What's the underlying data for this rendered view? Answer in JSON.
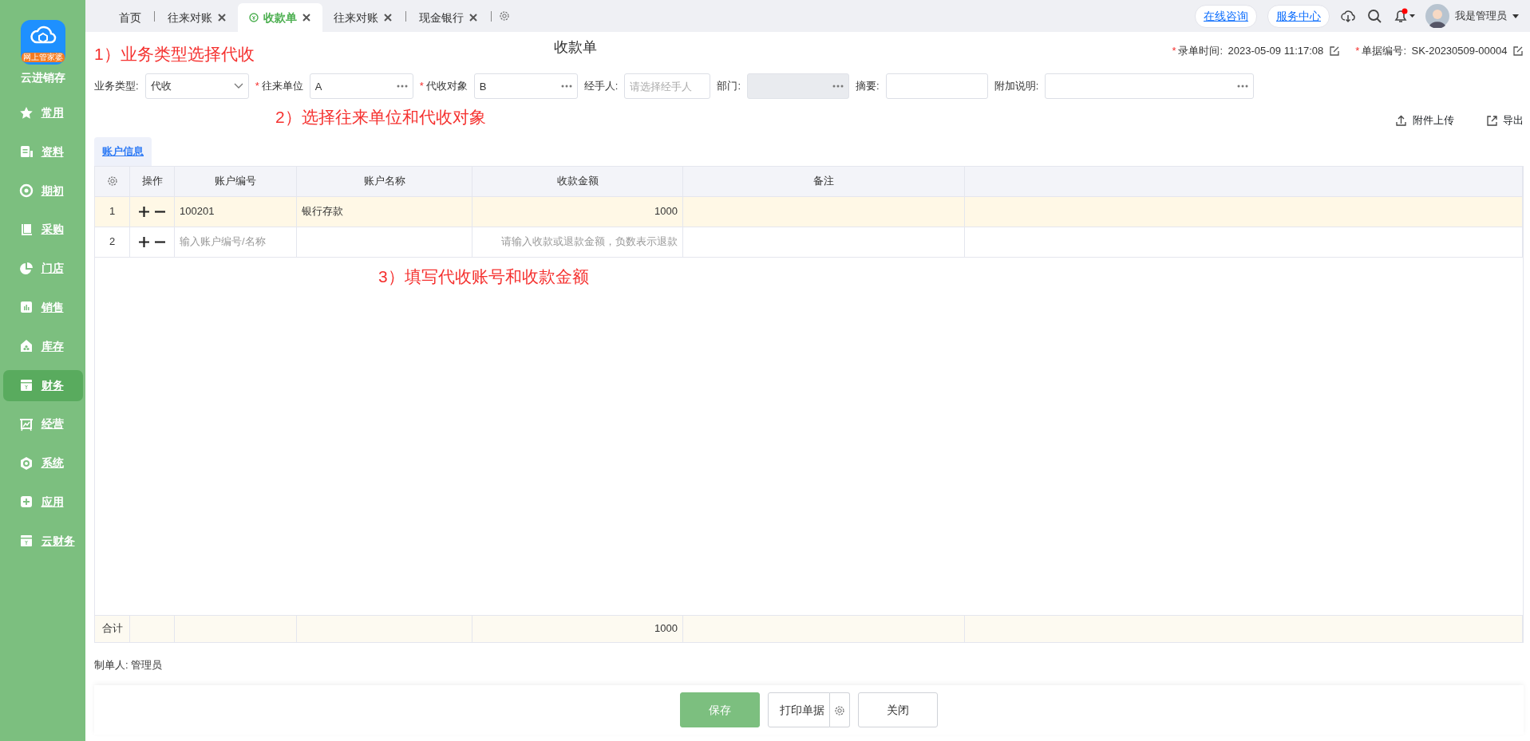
{
  "sidebar": {
    "logo_badge": "网上管家婆",
    "app_name": "云进销存",
    "items": [
      {
        "label": "常用",
        "selected": false
      },
      {
        "label": "资料",
        "selected": false
      },
      {
        "label": "期初",
        "selected": false
      },
      {
        "label": "采购",
        "selected": false
      },
      {
        "label": "门店",
        "selected": false
      },
      {
        "label": "销售",
        "selected": false
      },
      {
        "label": "库存",
        "selected": false
      },
      {
        "label": "财务",
        "selected": true
      },
      {
        "label": "经营",
        "selected": false
      },
      {
        "label": "系统",
        "selected": false
      },
      {
        "label": "应用",
        "selected": false
      },
      {
        "label": "云财务",
        "selected": false
      }
    ]
  },
  "tabs": [
    {
      "label": "首页",
      "selected": false,
      "closable": false
    },
    {
      "label": "往来对账",
      "selected": false,
      "closable": true
    },
    {
      "label": "收款单",
      "selected": true,
      "closable": true
    },
    {
      "label": "往来对账",
      "selected": false,
      "closable": true
    },
    {
      "label": "现金银行",
      "selected": false,
      "closable": true
    }
  ],
  "top_links": [
    "在线咨询",
    "服务中心"
  ],
  "notification_dot": true,
  "required_mark": "*",
  "user": {
    "name": "我是管理员"
  },
  "notes": [
    "1）业务类型选择代收",
    "2）选择往来单位和代收对象",
    "3）填写代收账号和收款金额"
  ],
  "title": "收款单",
  "meta": [
    {
      "label": "录单时间:",
      "value": "2023-05-09 11:17:08",
      "required": true
    },
    {
      "label": "单据编号:",
      "value": "SK-20230509-00004",
      "required": true
    }
  ],
  "form_fields": [
    {
      "label": "业务类型:",
      "value": "代收",
      "kind": "select",
      "required": false,
      "disabled": false
    },
    {
      "label": "往来单位",
      "value": "A",
      "kind": "picker",
      "required": true,
      "disabled": false
    },
    {
      "label": "代收对象",
      "value": "B",
      "kind": "picker",
      "required": true,
      "disabled": false
    },
    {
      "label": "经手人:",
      "placeholder": "请选择经手人",
      "kind": "text",
      "required": false,
      "disabled": false
    },
    {
      "label": "部门:",
      "kind": "picker",
      "required": false,
      "disabled": true
    },
    {
      "label": "摘要:",
      "kind": "text",
      "required": false,
      "disabled": false
    },
    {
      "label": "附加说明:",
      "kind": "picker",
      "required": false,
      "disabled": false
    }
  ],
  "actions": [
    {
      "label": "附件上传",
      "kind": "upload"
    },
    {
      "label": "导出",
      "kind": "export"
    }
  ],
  "section_tabs": [
    {
      "label": "账户信息",
      "selected": true
    }
  ],
  "table": {
    "columns": [
      "操作",
      "账户编号",
      "账户名称",
      "收款金额",
      "备注"
    ],
    "rows": [
      {
        "index": "1",
        "account_no": "100201",
        "account_name": "银行存款",
        "amount": "1000",
        "selected": true
      },
      {
        "index": "2",
        "account_no_placeholder": "输入账户编号/名称",
        "amount_placeholder": "请输入收款或退款金额，负数表示退款",
        "selected": false
      }
    ],
    "totals": {
      "label": "合计",
      "amount": "1000"
    }
  },
  "creator": {
    "label": "制单人:",
    "value": "管理员"
  },
  "buttons": [
    {
      "label": "保存",
      "kind": "primary"
    },
    {
      "label": "打印单据",
      "kind": "split"
    },
    {
      "label": "关闭",
      "kind": "default"
    }
  ]
}
